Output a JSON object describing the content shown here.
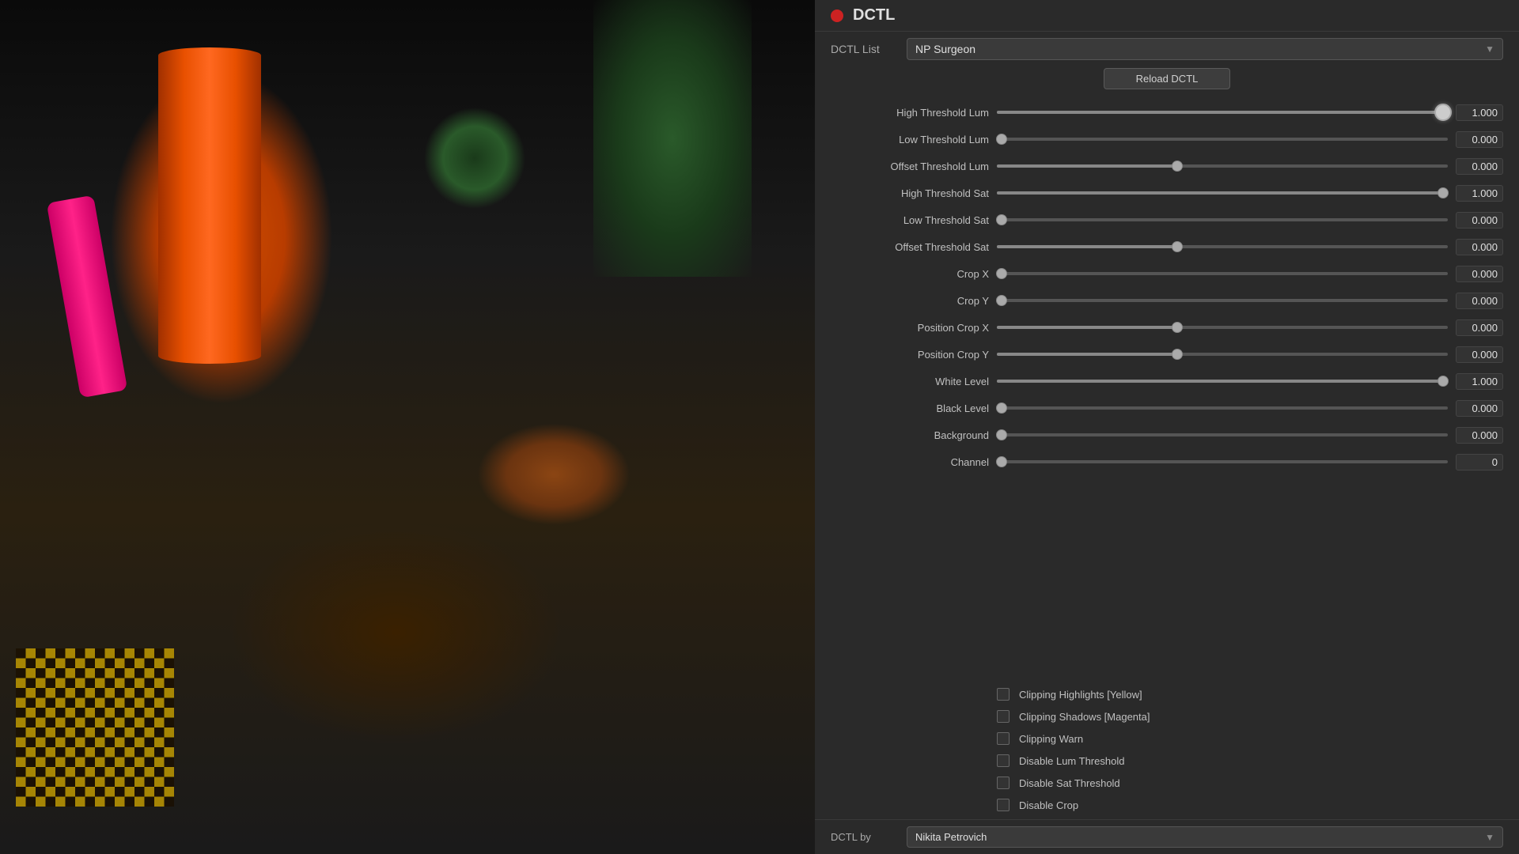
{
  "header": {
    "indicator_color": "#cc2222",
    "title": "DCTL"
  },
  "dctl_list": {
    "label": "DCTL List",
    "selected": "NP Surgeon",
    "options": [
      "NP Surgeon"
    ]
  },
  "reload_button": {
    "label": "Reload DCTL"
  },
  "params": [
    {
      "name": "high-threshold-lum",
      "label": "High Threshold Lum",
      "value": "1.000",
      "thumb_pct": 99,
      "active": true
    },
    {
      "name": "low-threshold-lum",
      "label": "Low Threshold Lum",
      "value": "0.000",
      "thumb_pct": 1,
      "active": false
    },
    {
      "name": "offset-threshold-lum",
      "label": "Offset Threshold Lum",
      "value": "0.000",
      "thumb_pct": 40,
      "active": false
    },
    {
      "name": "high-threshold-sat",
      "label": "High Threshold Sat",
      "value": "1.000",
      "thumb_pct": 99,
      "active": false
    },
    {
      "name": "low-threshold-sat",
      "label": "Low Threshold Sat",
      "value": "0.000",
      "thumb_pct": 1,
      "active": false
    },
    {
      "name": "offset-threshold-sat",
      "label": "Offset Threshold Sat",
      "value": "0.000",
      "thumb_pct": 40,
      "active": false
    },
    {
      "name": "crop-x",
      "label": "Crop X",
      "value": "0.000",
      "thumb_pct": 1,
      "active": false
    },
    {
      "name": "crop-y",
      "label": "Crop Y",
      "value": "0.000",
      "thumb_pct": 1,
      "active": false
    },
    {
      "name": "position-crop-x",
      "label": "Position Crop X",
      "value": "0.000",
      "thumb_pct": 40,
      "active": false
    },
    {
      "name": "position-crop-y",
      "label": "Position Crop Y",
      "value": "0.000",
      "thumb_pct": 40,
      "active": false
    },
    {
      "name": "white-level",
      "label": "White Level",
      "value": "1.000",
      "thumb_pct": 99,
      "active": false
    },
    {
      "name": "black-level",
      "label": "Black Level",
      "value": "0.000",
      "thumb_pct": 1,
      "active": false
    },
    {
      "name": "background",
      "label": "Background",
      "value": "0.000",
      "thumb_pct": 1,
      "active": false
    },
    {
      "name": "channel",
      "label": "Channel",
      "value": "0",
      "thumb_pct": 1,
      "active": false
    }
  ],
  "checkboxes": [
    {
      "name": "clipping-highlights",
      "label": "Clipping Highlights [Yellow]",
      "checked": false
    },
    {
      "name": "clipping-shadows",
      "label": "Clipping Shadows [Magenta]",
      "checked": false
    },
    {
      "name": "clipping-warn",
      "label": "Clipping Warn",
      "checked": false
    },
    {
      "name": "disable-lum-threshold",
      "label": "Disable Lum Threshold",
      "checked": false
    },
    {
      "name": "disable-sat-threshold",
      "label": "Disable Sat Threshold",
      "checked": false
    },
    {
      "name": "disable-crop",
      "label": "Disable Crop",
      "checked": false
    }
  ],
  "dctl_by": {
    "label": "DCTL by",
    "selected": "Nikita Petrovich",
    "options": [
      "Nikita Petrovich"
    ]
  }
}
